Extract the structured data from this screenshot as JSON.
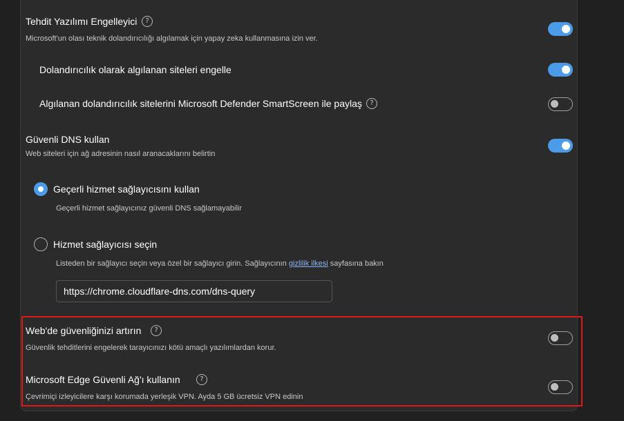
{
  "settings": {
    "phishing_blocker": {
      "title": "Tehdit Yazılımı Engelleyici",
      "desc": "Microsoft'un olası teknik dolandırıcılığı algılamak için yapay zeka kullanmasına izin ver.",
      "enabled": true
    },
    "block_scam_sites": {
      "title": "Dolandırıcılık olarak algılanan siteleri engelle",
      "enabled": true
    },
    "share_smartscreen": {
      "title": "Algılanan dolandırıcılık sitelerini Microsoft Defender SmartScreen ile paylaş",
      "enabled": false
    },
    "secure_dns": {
      "title": "Güvenli DNS kullan",
      "desc": "Web siteleri için ağ adresinin nasıl aranacaklarını belirtin",
      "enabled": true,
      "option_current": {
        "label": "Geçerli hizmet sağlayıcısını kullan",
        "desc": "Geçerli hizmet sağlayıcınız güvenli DNS sağlamayabilir",
        "selected": true
      },
      "option_choose": {
        "label": "Hizmet sağlayıcısı seçin",
        "desc_before": "Listeden bir sağlayıcı seçin veya özel bir sağlayıcı girin. Sağlayıcının ",
        "desc_link": "gizlilik ilkesi",
        "desc_after": " sayfasına bakın",
        "selected": false
      },
      "provider_url": "https://chrome.cloudflare-dns.com/dns-query"
    },
    "enhance_security": {
      "title": "Web'de güvenliğinizi artırın",
      "desc": "Güvenlik tehditlerini engelerek tarayıcınızı kötü amaçlı yazılımlardan korur.",
      "enabled": false
    },
    "secure_network": {
      "title": "Microsoft Edge Güvenli Ağ'ı kullanın",
      "desc": "Çevrimiçi izleyicilere karşı korumada yerleşik VPN. Ayda 5 GB ücretsiz VPN edinin",
      "enabled": false
    }
  },
  "icons": {
    "help": "?"
  },
  "colors": {
    "accent": "#4c9be8",
    "highlight": "#e01818",
    "link": "#8ab4f8"
  }
}
